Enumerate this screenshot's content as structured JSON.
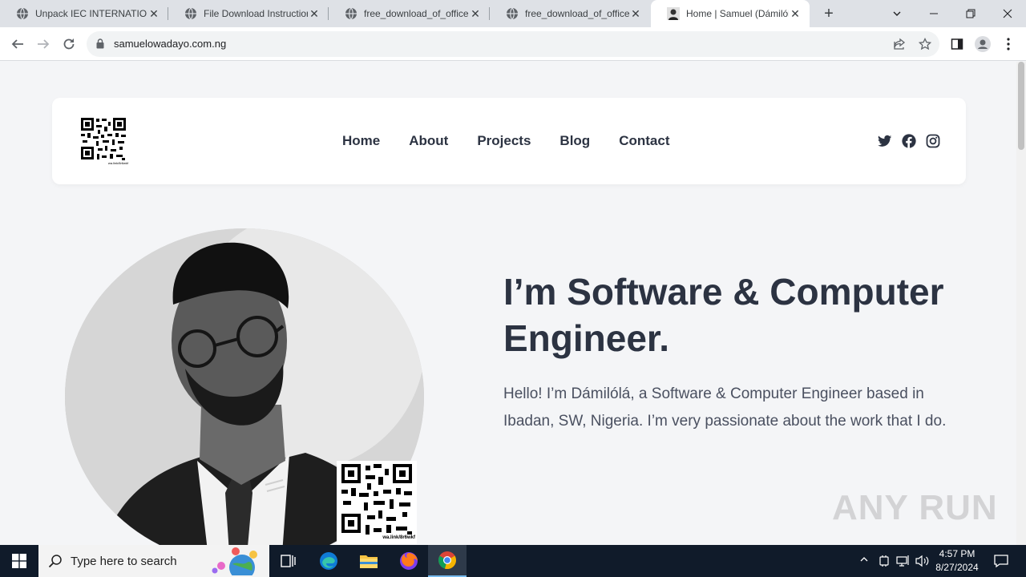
{
  "browser": {
    "tabs": [
      {
        "title": "Unpack IEC INTERNATIONAL",
        "active": false
      },
      {
        "title": "File Download Instructions",
        "active": false
      },
      {
        "title": "free_download_of_office",
        "active": false
      },
      {
        "title": "free_download_of_office",
        "active": false
      },
      {
        "title": "Home | Samuel (Dámilólá)",
        "active": true
      }
    ],
    "url": "samuelowadayo.com.ng"
  },
  "site": {
    "logo_caption": "wa.link/8r6wkf",
    "nav": [
      {
        "label": "Home"
      },
      {
        "label": "About"
      },
      {
        "label": "Projects"
      },
      {
        "label": "Blog"
      },
      {
        "label": "Contact"
      }
    ],
    "social": [
      {
        "icon": "twitter-icon"
      },
      {
        "icon": "facebook-icon"
      },
      {
        "icon": "instagram-icon"
      }
    ],
    "hero": {
      "title": "I’m Software & Computer Engineer.",
      "text": "Hello! I’m Dámilólá, a Software & Computer Engineer based in Ibadan, SW, Nigeria. I’m very passionate about the work that I do."
    },
    "qr_caption": "wa.link/8r6wkf"
  },
  "watermark": "ANY RUN",
  "taskbar": {
    "search_placeholder": "Type here to search",
    "time": "4:57 PM",
    "date": "8/27/2024"
  },
  "colors": {
    "heading": "#2c3342",
    "body_text": "#4a5060",
    "page_bg": "#f4f5f7",
    "taskbar_bg": "#101b2a"
  }
}
